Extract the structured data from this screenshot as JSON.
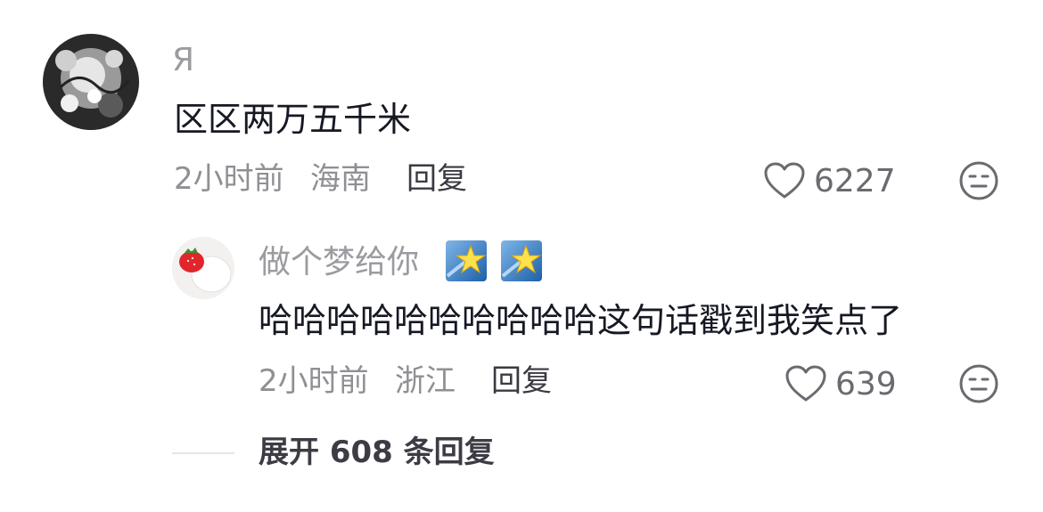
{
  "comment": {
    "username": "Я",
    "text": "区区两万五千米",
    "time": "2小时前",
    "location": "海南",
    "reply_label": "回复",
    "likes": "6227"
  },
  "reply": {
    "username": "做个梦给你",
    "badges": [
      "star-badge",
      "star-badge"
    ],
    "text": "哈哈哈哈哈哈哈哈哈哈这句话戳到我笑点了",
    "time": "2小时前",
    "location": "浙江",
    "reply_label": "回复",
    "likes": "639"
  },
  "expand": {
    "label": "展开 608 条回复"
  },
  "colors": {
    "primary_text": "#161823",
    "secondary_text": "#8f8f94",
    "username": "#9b9ba0"
  }
}
